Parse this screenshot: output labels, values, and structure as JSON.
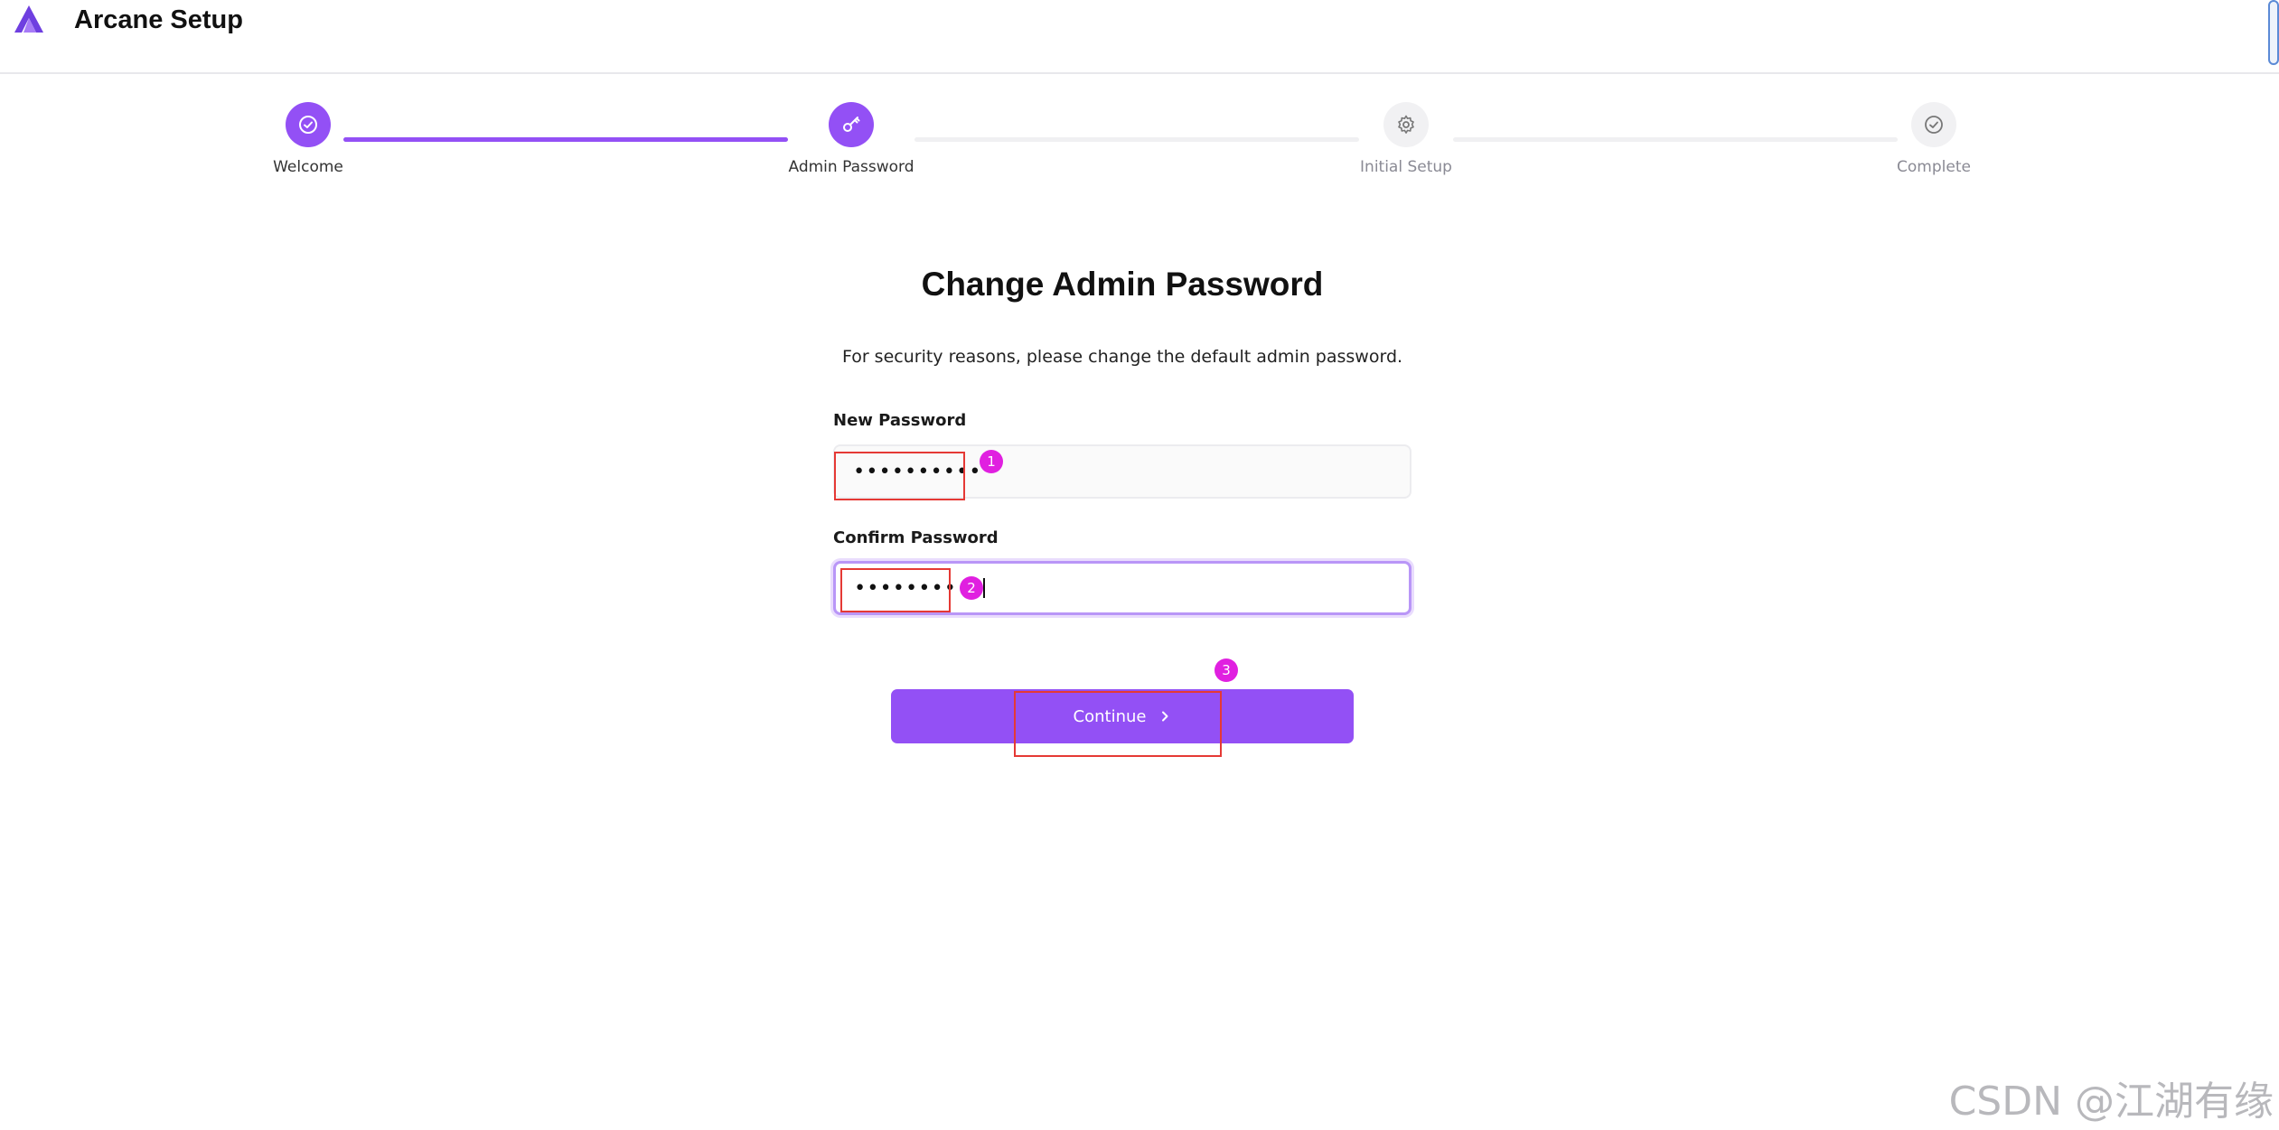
{
  "header": {
    "title": "Arcane Setup"
  },
  "steps": [
    {
      "label": "Welcome",
      "icon": "check-circle-icon",
      "state": "done"
    },
    {
      "label": "Admin Password",
      "icon": "key-icon",
      "state": "current"
    },
    {
      "label": "Initial Setup",
      "icon": "gear-icon",
      "state": "pending"
    },
    {
      "label": "Complete",
      "icon": "check-circle-icon",
      "state": "pending"
    }
  ],
  "main": {
    "title": "Change Admin Password",
    "subtitle": "For security reasons, please change the default admin password.",
    "new_password": {
      "label": "New Password",
      "value": "••••••••••"
    },
    "confirm_password": {
      "label": "Confirm Password",
      "value": "••••••••••"
    },
    "continue_label": "Continue"
  },
  "annotations": {
    "one": "1",
    "two": "2",
    "three": "3"
  },
  "watermark": "CSDN @江湖有缘",
  "colors": {
    "accent": "#9350f5",
    "annotation_box": "#e53935",
    "annotation_badge": "#e020e0"
  }
}
